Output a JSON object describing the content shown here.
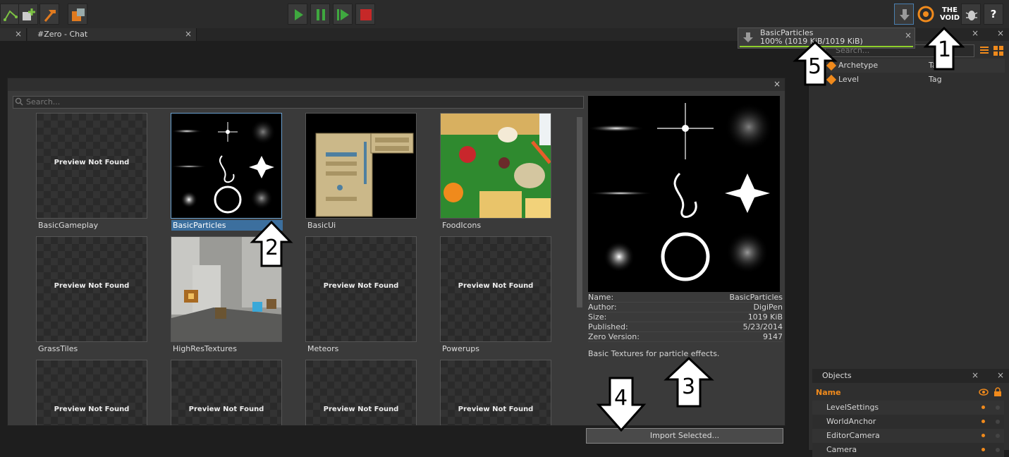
{
  "tabs": [
    {
      "label": ""
    },
    {
      "label": "#Zero - Chat"
    }
  ],
  "search": {
    "placeholder": "Search..."
  },
  "right_search": {
    "placeholder": "Search..."
  },
  "tiles": [
    {
      "name": "BasicGameplay",
      "preview": "Preview Not Found"
    },
    {
      "name": "BasicParticles",
      "preview": ""
    },
    {
      "name": "BasicUi",
      "preview": ""
    },
    {
      "name": "FoodIcons",
      "preview": ""
    },
    {
      "name": "GrassTiles",
      "preview": "Preview Not Found"
    },
    {
      "name": "HighResTextures",
      "preview": ""
    },
    {
      "name": "Meteors",
      "preview": "Preview Not Found"
    },
    {
      "name": "Powerups",
      "preview": "Preview Not Found"
    },
    {
      "name": "",
      "preview": "Preview Not Found"
    },
    {
      "name": "",
      "preview": "Preview Not Found"
    },
    {
      "name": "",
      "preview": "Preview Not Found"
    },
    {
      "name": "",
      "preview": "Preview Not Found"
    }
  ],
  "details": {
    "name_key": "Name:",
    "name": "BasicParticles",
    "author_key": "Author:",
    "author": "DigiPen",
    "size_key": "Size:",
    "size": "1019 KiB",
    "published_key": "Published:",
    "published": "5/23/2014",
    "version_key": "Zero Version:",
    "version": "9147",
    "description": "Basic Textures for particle effects."
  },
  "import_label": "Import Selected...",
  "notification": {
    "title": "BasicParticles",
    "progress_text": "100% (1019 KiB/1019 KiB)",
    "progress": 1.0
  },
  "brand": {
    "line1": "THE",
    "line2": "VOID"
  },
  "help": "?",
  "library_rows": [
    {
      "name": "Archetype",
      "type": "Ta"
    },
    {
      "name": "Level",
      "type": "Tag"
    }
  ],
  "objects_panel": {
    "title": "Objects",
    "header": "Name",
    "items": [
      "LevelSettings",
      "WorldAnchor",
      "EditorCamera",
      "Camera"
    ]
  },
  "callouts": [
    "1",
    "2",
    "3",
    "4",
    "5"
  ],
  "colors": {
    "accent": "#f08a1c",
    "selection": "#3c6f9e",
    "progress": "#8ed02b",
    "play": "#3fa83f",
    "stop": "#c62828"
  }
}
